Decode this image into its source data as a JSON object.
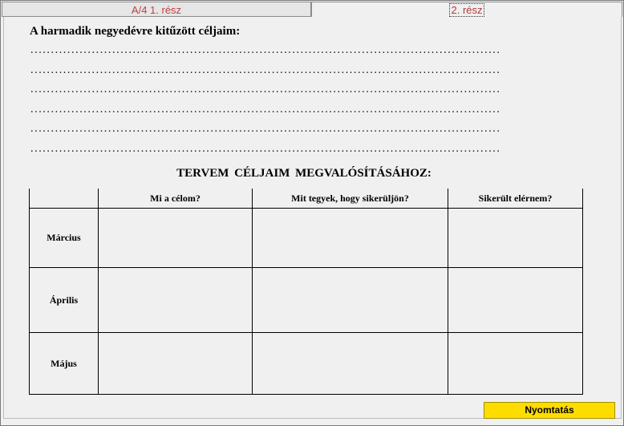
{
  "tabs": [
    {
      "label": "A/4  1. rész"
    },
    {
      "label": "2. rész"
    }
  ],
  "goals_title": "A harmadik negyedévre kitűzött céljaim:",
  "dot_line": "...................................................................................................................",
  "plan_title": "TERVEM  CÉLJAIM  MEGVALÓSÍTÁSÁHOZ:",
  "table": {
    "headers": [
      "",
      "Mi a célom?",
      "Mit tegyek, hogy sikerüljön?",
      "Sikerült elérnem?"
    ],
    "rows": [
      "Március",
      "Április",
      "Május"
    ]
  },
  "print_button": "Nyomtatás"
}
